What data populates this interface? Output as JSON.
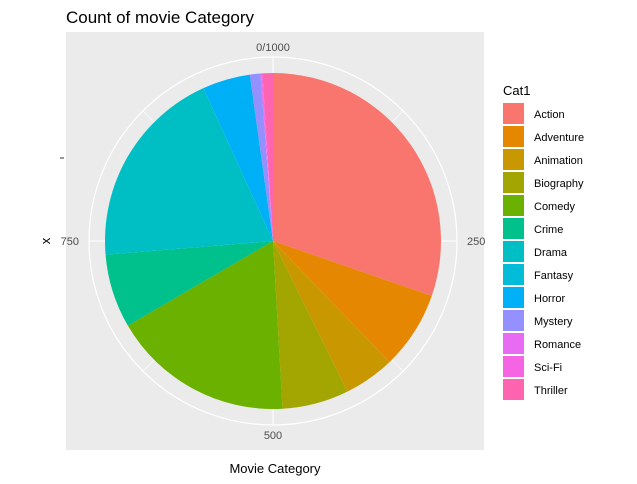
{
  "chart_data": {
    "type": "pie",
    "title": "Count of movie Category",
    "xlabel": "Movie Category",
    "ylabel": "x",
    "total": 1000,
    "theta_ticks": [
      {
        "value": 0,
        "label": "0/1000"
      },
      {
        "value": 250,
        "label": "250"
      },
      {
        "value": 500,
        "label": "500"
      },
      {
        "value": 750,
        "label": "750"
      }
    ],
    "legend_title": "Cat1",
    "legend_position": "right",
    "grid": true,
    "categories": [
      "Action",
      "Adventure",
      "Animation",
      "Biography",
      "Comedy",
      "Crime",
      "Drama",
      "Fantasy",
      "Horror",
      "Mystery",
      "Romance",
      "Sci-Fi",
      "Thriller"
    ],
    "colors": [
      "#F8766D",
      "#E58700",
      "#C99800",
      "#A3A500",
      "#6BB100",
      "#00BA38",
      "#00BF7D",
      "#00C0AF",
      "#00BCD8",
      "#00B0F6",
      "#619CFF",
      "#B983FF",
      "#E76BF3",
      "#FD61D1",
      "#FF67A4"
    ],
    "slices": [
      {
        "label": "Action",
        "value": 303,
        "color": "#F8766D"
      },
      {
        "label": "Adventure",
        "value": 75,
        "color": "#E58700"
      },
      {
        "label": "Animation",
        "value": 49,
        "color": "#C99800"
      },
      {
        "label": "Biography",
        "value": 64,
        "color": "#A3A500"
      },
      {
        "label": "Comedy",
        "value": 175,
        "color": "#6BB100"
      },
      {
        "label": "Crime",
        "value": 71,
        "color": "#00C08B"
      },
      {
        "label": "Drama",
        "value": 195,
        "color": "#00BFC4"
      },
      {
        "label": "Fantasy",
        "value": 0,
        "color": "#00BCD8"
      },
      {
        "label": "Horror",
        "value": 46,
        "color": "#00B0F6"
      },
      {
        "label": "Mystery",
        "value": 10,
        "color": "#9590FF"
      },
      {
        "label": "Romance",
        "value": 1,
        "color": "#E76BF3"
      },
      {
        "label": "Sci-Fi",
        "value": 1,
        "color": "#F564E3"
      },
      {
        "label": "Thriller",
        "value": 10,
        "color": "#FF64B0"
      }
    ]
  }
}
